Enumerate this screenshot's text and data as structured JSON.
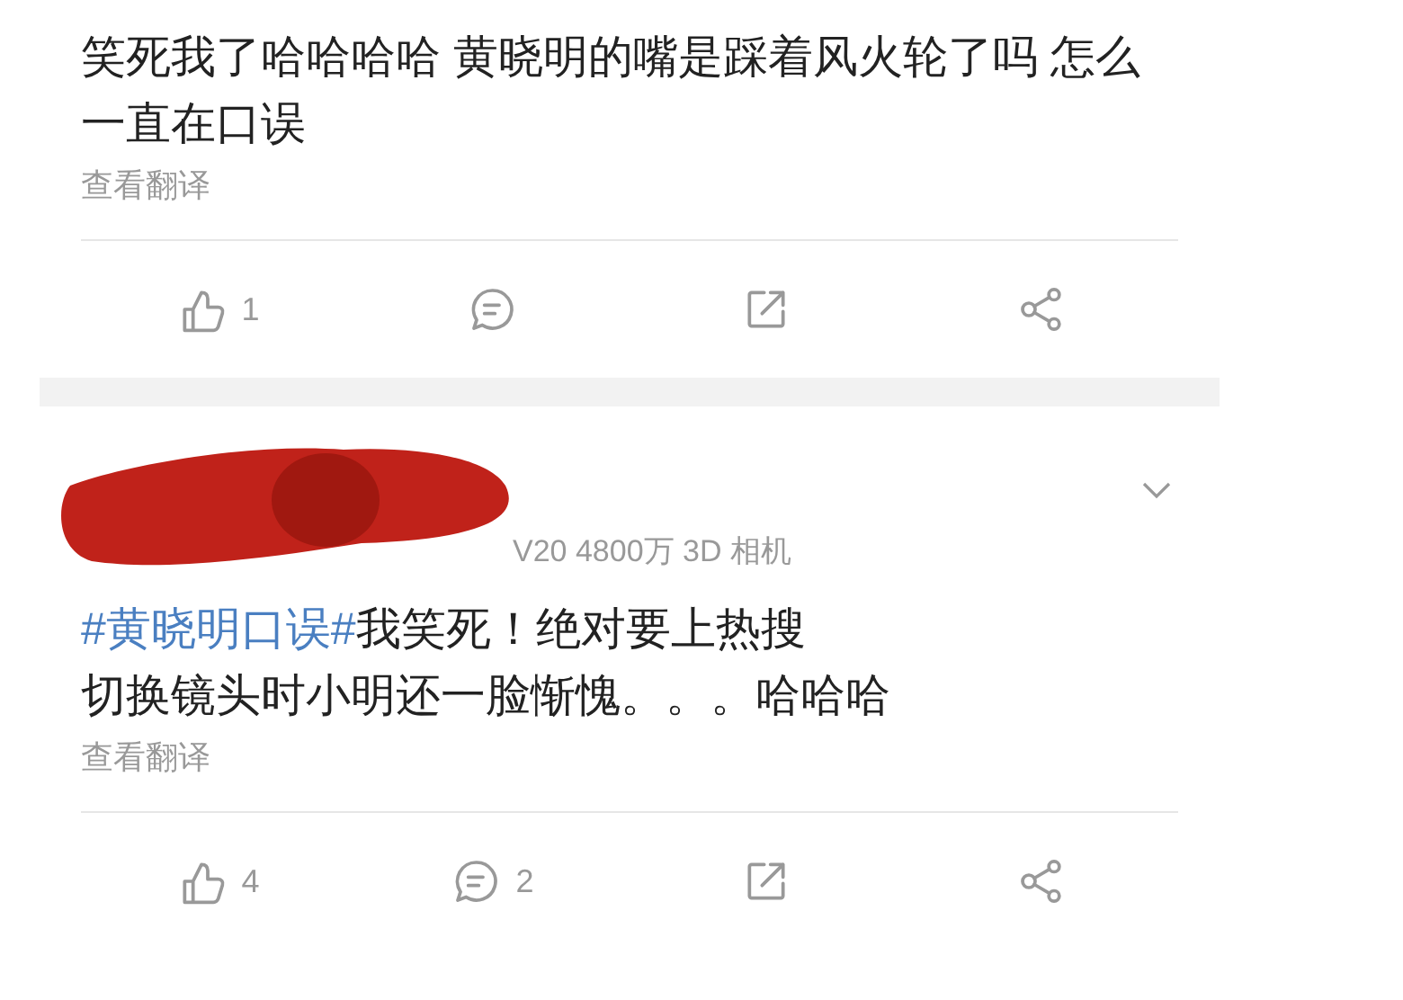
{
  "posts": [
    {
      "lines": [
        [
          {
            "kind": "text",
            "text": "笑死我了哈哈哈哈 黄晓明的嘴是踩着风火轮了吗 怎么一直在口误"
          }
        ]
      ],
      "translate": "查看翻译",
      "actions": [
        {
          "kind": "like",
          "count": "1"
        },
        {
          "kind": "comment"
        },
        {
          "kind": "repost"
        },
        {
          "kind": "share"
        }
      ]
    },
    {
      "header": {
        "redacted": true,
        "source": "V20 4800万 3D 相机"
      },
      "lines": [
        [
          {
            "kind": "hashtag",
            "text": "#黄晓明口误#"
          },
          {
            "kind": "text",
            "text": "我笑死！绝对要上热搜"
          }
        ],
        [
          {
            "kind": "text",
            "text": "切换镜头时小明还一脸惭愧。。。哈哈哈"
          }
        ]
      ],
      "translate": "查看翻译",
      "actions": [
        {
          "kind": "like",
          "count": "4"
        },
        {
          "kind": "comment",
          "count": "2"
        },
        {
          "kind": "repost"
        },
        {
          "kind": "share"
        }
      ]
    }
  ]
}
